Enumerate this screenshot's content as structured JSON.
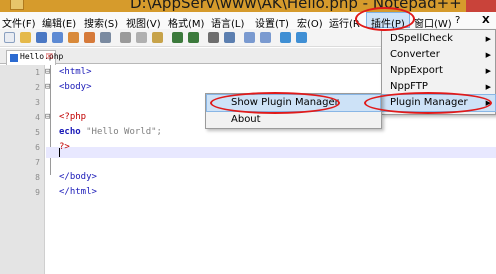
{
  "window": {
    "title": "D:\\AppServ\\www\\AK\\Hello.php - Notepad++ [Administrator]"
  },
  "menu": {
    "file": "文件(F)",
    "edit": "编辑(E)",
    "search": "搜索(S)",
    "view": "视图(V)",
    "format": "格式(M)",
    "language": "语言(L)",
    "settings": "设置(T)",
    "macro": "宏(O)",
    "run": "运行(R",
    "plugins": "插件(P)",
    "window": "窗口(W)",
    "help": "?",
    "close": "X"
  },
  "tab": {
    "label": "Hello.php",
    "close": "☒"
  },
  "editor": {
    "line_numbers": [
      "1",
      "2",
      "3",
      "4",
      "5",
      "6",
      "7",
      "8",
      "9"
    ],
    "line1": "<html>",
    "line2": "<body>",
    "line4": "<?php",
    "line5_kw": "echo",
    "line5_str": "\"Hello World\";",
    "line6": "?>",
    "line8": "</body>",
    "line9": "</html>"
  },
  "plugins_menu": {
    "items": [
      {
        "label": "DSpellCheck"
      },
      {
        "label": "Converter"
      },
      {
        "label": "NppExport"
      },
      {
        "label": "NppFTP"
      },
      {
        "label": "Plugin Manager"
      }
    ],
    "arrow": "▶"
  },
  "plugin_manager_submenu": {
    "items": [
      {
        "label": "Show Plugin Manager"
      },
      {
        "label": "About"
      }
    ]
  },
  "colors": {
    "highlight": "#cde2f7",
    "annotation": "#e01a1a",
    "tag": "#1a1ab8",
    "php": "#c10000"
  }
}
